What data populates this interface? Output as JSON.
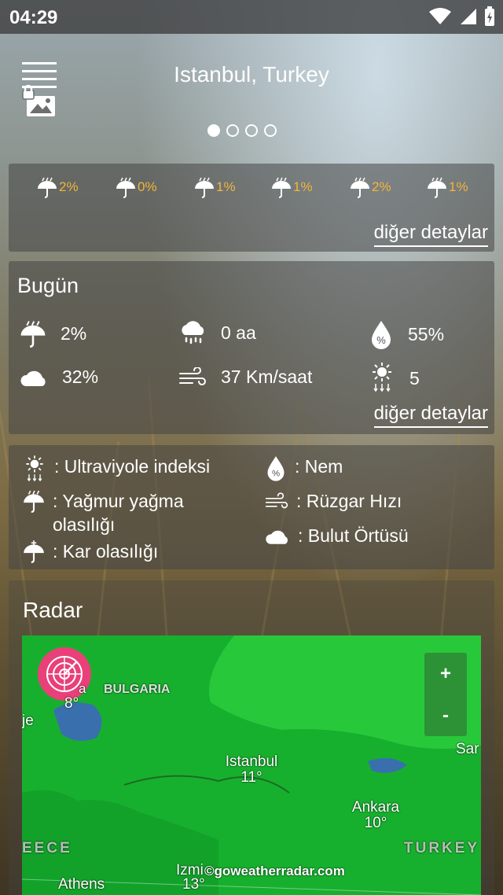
{
  "status_bar": {
    "time": "04:29"
  },
  "header": {
    "title": "Istanbul, Turkey",
    "menu_icon": "hamburger-icon",
    "wallpaper_icon": "lock-image-icon"
  },
  "pager": {
    "total": 4,
    "active": 1
  },
  "hourly": {
    "items": [
      {
        "icon": "umbrella-rain-icon",
        "value": "2%"
      },
      {
        "icon": "umbrella-rain-icon",
        "value": "0%"
      },
      {
        "icon": "umbrella-rain-icon",
        "value": "1%"
      },
      {
        "icon": "umbrella-rain-icon",
        "value": "1%"
      },
      {
        "icon": "umbrella-rain-icon",
        "value": "2%"
      },
      {
        "icon": "umbrella-rain-icon",
        "value": "1%"
      }
    ],
    "more_label": "diğer detaylar",
    "accent_color": "#f2b53a"
  },
  "today": {
    "title": "Bugün",
    "stats": [
      {
        "icon": "umbrella-rain-icon",
        "value": "2%"
      },
      {
        "icon": "cloud-rain-icon",
        "value": "0 aa"
      },
      {
        "icon": "humidity-drop-icon",
        "value": "55%"
      },
      {
        "icon": "cloud-icon",
        "value": "32%"
      },
      {
        "icon": "wind-icon",
        "value": "37 Km/saat"
      },
      {
        "icon": "uv-sun-icon",
        "value": "5"
      }
    ],
    "more_label": "diğer detaylar"
  },
  "legend": {
    "items": [
      {
        "icon": "uv-sun-icon",
        "label": ": Ultraviyole indeksi"
      },
      {
        "icon": "humidity-drop-icon",
        "label": ": Nem"
      },
      {
        "icon": "umbrella-rain-icon",
        "label": ": Yağmur yağma olasılığı"
      },
      {
        "icon": "wind-icon",
        "label": ": Rüzgar Hızı"
      },
      {
        "icon": "umbrella-snow-icon",
        "label": ": Kar olasılığı"
      },
      {
        "icon": "cloud-icon",
        "label": ": Bulut Örtüsü"
      }
    ]
  },
  "radar": {
    "title": "Radar",
    "zoom_in": "+",
    "zoom_out": "-",
    "labels": {
      "bulgaria": "BULGARIA",
      "sofia_partial": "a",
      "sofia_temp": "8°",
      "skopje_partial": "je",
      "istanbul": "Istanbul",
      "istanbul_temp": "11°",
      "ankara": "Ankara",
      "ankara_temp": "10°",
      "samsun_partial": "Sar",
      "greece_partial": "EECE",
      "turkey": "TURKEY",
      "izmir_partial": "Izmi",
      "izmir_temp": "13°",
      "athens_partial": "Athens",
      "attribution": "©goweatherradar.com"
    },
    "colors": {
      "land": "#19b830",
      "sea": "#3a6fae",
      "fab": "#e9407a"
    }
  }
}
